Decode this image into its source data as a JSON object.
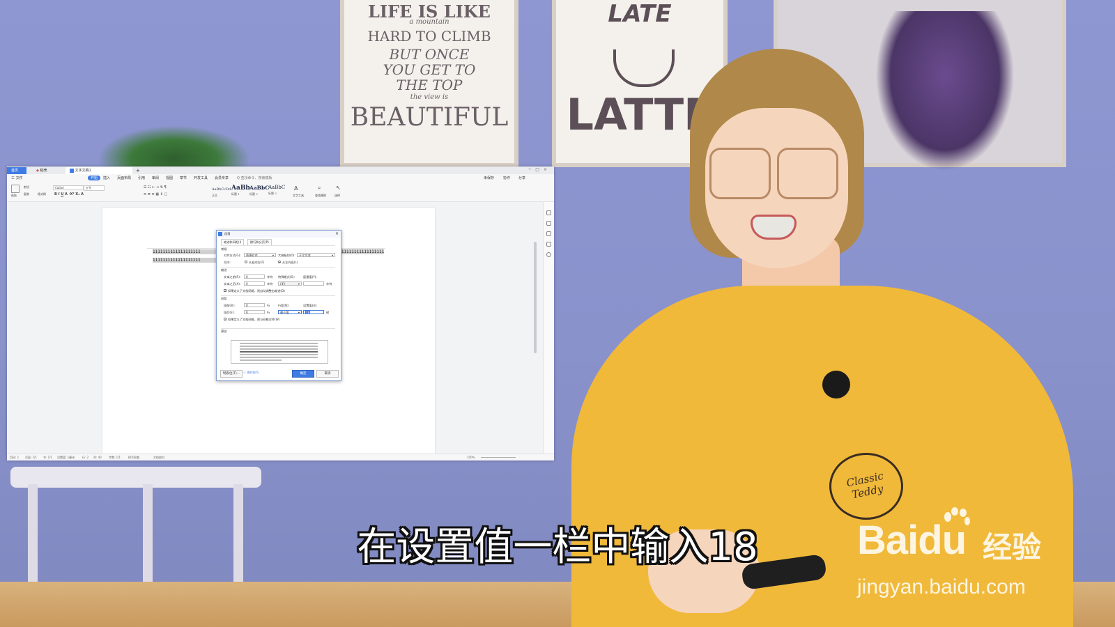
{
  "background": {
    "poster_left": [
      "LIFE IS LIKE",
      "a mountain",
      "HARD TO CLIMB",
      "BUT ONCE",
      "YOU GET TO",
      "THE TOP",
      "the view is",
      "BEAUTIFUL"
    ],
    "poster_center": [
      "LATE",
      "LATTE"
    ],
    "shirt_logo": "Classic Teddy"
  },
  "app": {
    "tabs": {
      "home": "首页",
      "docer": "稻壳",
      "doc": "文字文稿1",
      "plus": "+"
    },
    "menu": {
      "file": "三 文件",
      "start": "开始",
      "insert": "插入",
      "layout": "页面布局",
      "reference": "引用",
      "review": "审阅",
      "view": "视图",
      "section": "章节",
      "dev": "开发工具",
      "member": "会员专享",
      "search": "Q 查找命令、搜索模板",
      "cloud": "未保存",
      "collab": "协作",
      "share": "分享"
    },
    "ribbon": {
      "paste": "粘贴",
      "cut": "剪切",
      "copy": "复制",
      "format_painter": "格式刷",
      "font": "Calibri",
      "size": "五号",
      "style_normal": "AaBbCcDd",
      "style_h1": "AaBb",
      "style_h2": "AaBbC",
      "style_h3": "AaBbC",
      "label_normal": "正文",
      "label_h1": "标题 1",
      "label_h2": "标题 2",
      "label_h3": "标题 3",
      "text_tools": "文字工具",
      "find_replace": "查找替换",
      "select": "选择"
    },
    "document": {
      "line1_left": "1111111111111111111",
      "line2_left": "1111111111111111111",
      "line1_right": "11111111111111111111"
    },
    "status": {
      "page": "页码: 1",
      "pages": "页面: 1/1",
      "section": "节: 1/1",
      "setting": "设置值: 1厘米",
      "row": "行: 2",
      "col": "列: 40",
      "words": "字数: 1/1",
      "spell": "拼写检查",
      "compat": "文档校对",
      "zoom": "100%"
    }
  },
  "dialog": {
    "title": "段落",
    "tab_indent": "缩进和间距(I)",
    "tab_break": "换行和分页(P)",
    "group_general": "常规",
    "align_label": "对齐方式(G):",
    "align_value": "两端对齐",
    "outline_label": "大纲级别(O):",
    "outline_value": "正文文本",
    "direction_label": "方向:",
    "rtl": "从右向左(F)",
    "ltr": "从左向右(L)",
    "group_indent": "缩进",
    "before_text_label": "文本之前(R):",
    "before_text_value": "0",
    "unit_char": "字符",
    "special_label": "特殊格式(S):",
    "measure_label": "度量值(Y):",
    "after_text_label": "文本之后(X):",
    "after_text_value": "0",
    "special_value": "(无)",
    "indent_grid_check": "如果定义了文档网格，则自动调整右缩进(D)",
    "group_spacing": "间距",
    "before_label": "段前(B):",
    "before_value": "0",
    "unit_line": "行",
    "line_spacing_label": "行距(N):",
    "setting_label": "设置值(A):",
    "after_label": "段后(E):",
    "after_value": "0",
    "line_spacing_value": "最小值",
    "setting_value": "18",
    "unit_pound": "磅",
    "spacing_grid_check": "如果定义了文档网格，则与网格对齐(W)",
    "group_preview": "预览",
    "tabs_button": "制表位(T)...",
    "tips": "操作技巧",
    "ok": "确定",
    "cancel": "取消"
  },
  "subtitle": "在设置值一栏中输入18",
  "watermark": {
    "brand": "Bai",
    "brand2": "du",
    "jingyan": "经验",
    "url": "jingyan.baidu.com"
  }
}
